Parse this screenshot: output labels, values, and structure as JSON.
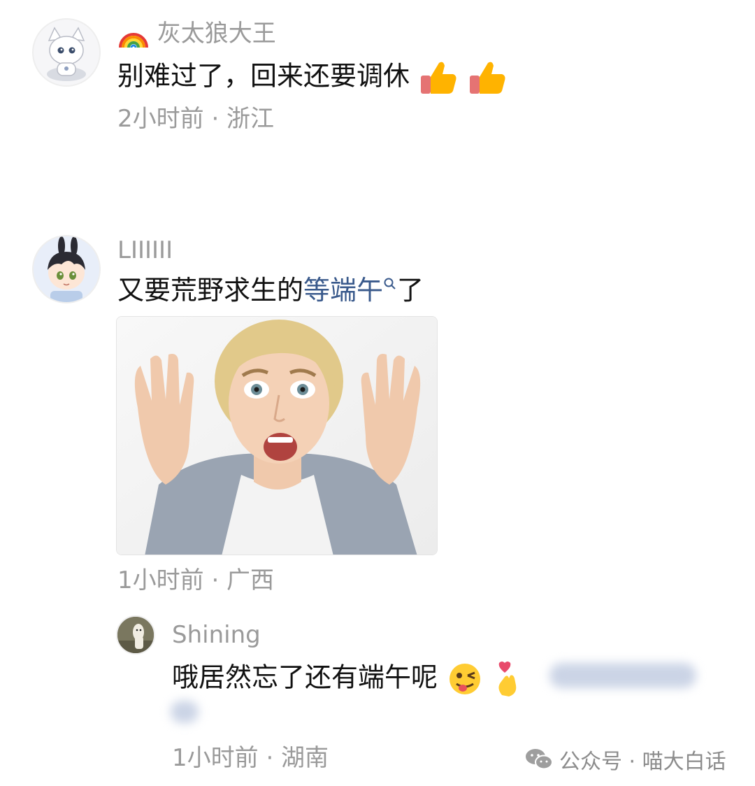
{
  "comments": [
    {
      "username": "灰太狼大王",
      "text": "别难过了，回来还要调休",
      "meta": "2小时前 · 浙江",
      "emojis": [
        "thumbs-up-icon",
        "thumbs-up-icon"
      ]
    },
    {
      "username": "LIIIIII",
      "text_before_link": "又要荒野求生的",
      "link_text": "等端午",
      "text_after_link": "了",
      "meta": "1小时前 · 广西",
      "image_alt": "surprised-woman-meme"
    }
  ],
  "reply": {
    "username": "Shining",
    "text": "哦居然忘了还有端午呢",
    "meta": "1小时前 · 湖南",
    "emojis": [
      "winking-tongue-face-icon",
      "finger-heart-icon"
    ]
  },
  "watermark": {
    "text": "公众号 · 喵大白话",
    "icon": "wechat-icon"
  },
  "colors": {
    "name": "#9a9a9a",
    "link": "#3a5a8c",
    "text": "#111111"
  }
}
